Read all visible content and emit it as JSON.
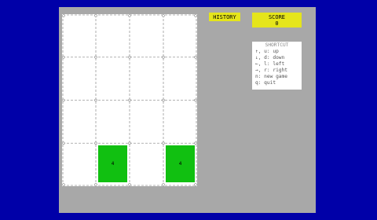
{
  "header": {
    "history_label": "HISTORY",
    "score_label": "SCORE",
    "score_value": "0"
  },
  "board": {
    "rows": 4,
    "cols": 4,
    "tiles": [
      {
        "row": 3,
        "col": 1,
        "value": "4"
      },
      {
        "row": 3,
        "col": 3,
        "value": "4"
      }
    ]
  },
  "shortcut": {
    "title": "SHORTCUT",
    "items": [
      "↑, u: up",
      "↓, d: down",
      "←, l: left",
      "→, r: right",
      "n: new game",
      "q: quit"
    ]
  },
  "colors": {
    "background": "#0000a8",
    "window": "#a8a8a8",
    "tile": "#11c011",
    "accent": "#e5e51b"
  }
}
